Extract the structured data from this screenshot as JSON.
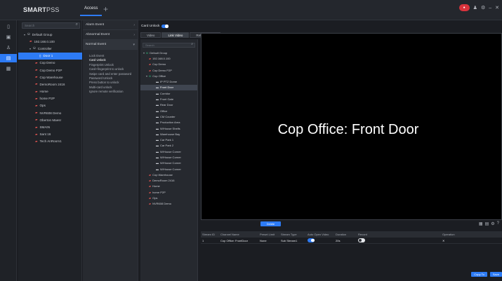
{
  "app": {
    "title_bold": "SMART",
    "title_light": "PSS"
  },
  "top_tabs": [
    {
      "label": "Access"
    }
  ],
  "top_right": {
    "badge": "●"
  },
  "device_tree": {
    "search_placeholder": "Search",
    "items": [
      {
        "label": "Default Group",
        "kind": "group",
        "level": 0
      },
      {
        "label": "192.168.0.100",
        "kind": "device",
        "level": 1
      },
      {
        "label": "Controller",
        "kind": "group",
        "level": 1
      },
      {
        "label": "Door 1",
        "kind": "door",
        "level": 2,
        "selected": true
      },
      {
        "label": "Cop Demo",
        "kind": "device",
        "level": 2
      },
      {
        "label": "Cop Demo P2P",
        "kind": "device",
        "level": 2
      },
      {
        "label": "Cop Warehouse",
        "kind": "device",
        "level": 2
      },
      {
        "label": "DemoRoom 2416",
        "kind": "device",
        "level": 2
      },
      {
        "label": "Home",
        "kind": "device",
        "level": 2
      },
      {
        "label": "home P2P",
        "kind": "device",
        "level": 2
      },
      {
        "label": "Ops",
        "kind": "device",
        "level": 2
      },
      {
        "label": "NVR608 Demo",
        "kind": "device",
        "level": 2
      },
      {
        "label": "Oberton Maesr",
        "kind": "device",
        "level": 2
      },
      {
        "label": "SMAIN",
        "kind": "device",
        "level": 2
      },
      {
        "label": "Sant 16",
        "kind": "device",
        "level": 2
      },
      {
        "label": "Tech AnRoom1",
        "kind": "device",
        "level": 2
      }
    ]
  },
  "event_menu": {
    "headers": [
      {
        "label": "Alarm Event"
      },
      {
        "label": "Abnormal Event"
      },
      {
        "label": "Normal Event"
      }
    ],
    "items": [
      {
        "label": "Lock Event"
      },
      {
        "label": "Card Unlock",
        "selected": true
      },
      {
        "label": "Fingerprint Unlock"
      },
      {
        "label": "Card+fingerprint to unlock"
      },
      {
        "label": "Swipe card and enter password"
      },
      {
        "label": "Password Unlock"
      },
      {
        "label": "Press button to unlock"
      },
      {
        "label": "Multi-card unlock"
      },
      {
        "label": "Ignore remote verification"
      }
    ]
  },
  "main": {
    "card_unlock_label": "Card Unlock",
    "card_unlock_enabled": true,
    "subtabs": [
      {
        "label": "Video"
      },
      {
        "label": "Link Video",
        "active": true
      },
      {
        "label": "Relieve Time"
      }
    ],
    "live_search_placeholder": "Search",
    "live_tree": [
      {
        "label": "Default Group",
        "kind": "group"
      },
      {
        "label": "192.168.0.100",
        "kind": "device"
      },
      {
        "label": "Cop Demo",
        "kind": "device"
      },
      {
        "label": "Cop Demo P2P",
        "kind": "device"
      },
      {
        "label": "Cop Office",
        "kind": "group"
      },
      {
        "label": "IP PTZ Dome",
        "kind": "camera"
      },
      {
        "label": "Front Door",
        "kind": "camera",
        "selected": true
      },
      {
        "label": "Corridor",
        "kind": "camera"
      },
      {
        "label": "Front Gate",
        "kind": "camera"
      },
      {
        "label": "Rear Door",
        "kind": "camera"
      },
      {
        "label": "Office",
        "kind": "camera"
      },
      {
        "label": "CM Counter",
        "kind": "camera"
      },
      {
        "label": "Production Area",
        "kind": "camera"
      },
      {
        "label": "W/House Shelfs",
        "kind": "camera"
      },
      {
        "label": "Warehouse Bay",
        "kind": "camera"
      },
      {
        "label": "Car Park 1",
        "kind": "camera"
      },
      {
        "label": "Car Park 2",
        "kind": "camera"
      },
      {
        "label": "W/House Corner",
        "kind": "camera"
      },
      {
        "label": "W/House Corner",
        "kind": "camera"
      },
      {
        "label": "W/House Corner",
        "kind": "camera"
      },
      {
        "label": "W/House Corner",
        "kind": "camera"
      },
      {
        "label": "Cop Warehouse",
        "kind": "device"
      },
      {
        "label": "DemoRoom 2416",
        "kind": "device"
      },
      {
        "label": "Home",
        "kind": "device"
      },
      {
        "label": "home P2P",
        "kind": "device"
      },
      {
        "label": "Ops",
        "kind": "device"
      },
      {
        "label": "NVR608 Demo",
        "kind": "device"
      }
    ],
    "video_title": "Cop Office: Front Door",
    "delete_button": "Delete",
    "table": {
      "columns": [
        "Stream ID",
        "Channel Name",
        "Preset Limit",
        "Stream Type",
        "Auto Open Video",
        "Duration",
        "Record",
        "Operation"
      ],
      "rows": [
        {
          "id": "1",
          "channel": "Cop Office: FrontDoor",
          "preset": "None",
          "stream": "Sub Stream1",
          "auto_open": true,
          "duration": "20s",
          "record": false,
          "op": "✕"
        }
      ]
    },
    "footer": {
      "ok": "Copy To",
      "save": "Save"
    }
  }
}
